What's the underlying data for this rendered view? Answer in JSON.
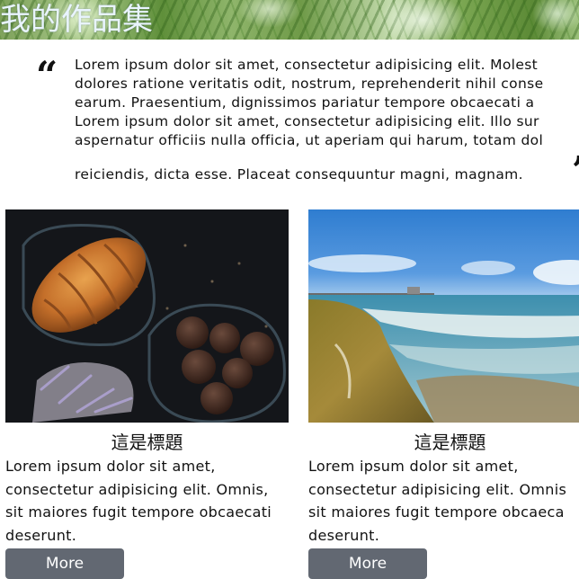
{
  "header": {
    "title": "我的作品集"
  },
  "quote": {
    "open_mark": "“",
    "close_mark": "”",
    "lines": [
      "Lorem ipsum dolor sit amet, consectetur adipisicing elit. Molest",
      "dolores ratione veritatis odit, nostrum, reprehenderit nihil conse",
      "earum. Praesentium, dignissimos pariatur tempore obcaecati a",
      "Lorem ipsum dolor sit amet, consectetur adipisicing elit. Illo sur",
      "aspernatur officiis nulla officia, ut aperiam qui harum, totam dol",
      "reiciendis, dicta esse. Placeat consequuntur magni, magnam."
    ]
  },
  "cards": [
    {
      "image": "croissant-and-chocolate-truffles-photo",
      "title": "這是標題",
      "text_lines": [
        "Lorem ipsum dolor sit amet,",
        "consectetur adipisicing elit. Omnis,",
        "sit maiores fugit tempore obcaecati",
        "deserunt."
      ],
      "button_label": "More"
    },
    {
      "image": "beach-shoreline-with-pier-photo",
      "title": "這是標題",
      "text_lines": [
        "Lorem ipsum dolor sit amet,",
        "consectetur adipisicing elit. Omnis",
        "sit maiores fugit tempore obcaeca",
        "deserunt."
      ],
      "button_label": "More"
    }
  ],
  "colors": {
    "header_text": "#e9f4ff",
    "button_bg": "#626872",
    "button_text": "#ffffff"
  }
}
